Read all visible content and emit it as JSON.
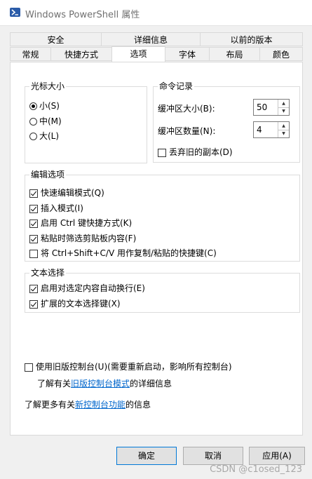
{
  "window": {
    "title": "Windows PowerShell 属性"
  },
  "tabs_row1": [
    "安全",
    "详细信息",
    "以前的版本"
  ],
  "tabs_row2": [
    "常规",
    "快捷方式",
    "选项",
    "字体",
    "布局",
    "颜色"
  ],
  "active_tab": "选项",
  "cursor_size": {
    "legend": "光标大小",
    "options": [
      {
        "label": "小(S)",
        "checked": true
      },
      {
        "label": "中(M)",
        "checked": false
      },
      {
        "label": "大(L)",
        "checked": false
      }
    ]
  },
  "command_history": {
    "legend": "命令记录",
    "buffer_size_label": "缓冲区大小(B):",
    "buffer_size_value": "50",
    "buffer_count_label": "缓冲区数量(N):",
    "buffer_count_value": "4",
    "discard_label": "丢弃旧的副本(D)",
    "discard_checked": false
  },
  "edit_options": {
    "legend": "编辑选项",
    "items": [
      {
        "label": "快速编辑模式(Q)",
        "checked": true
      },
      {
        "label": "插入模式(I)",
        "checked": true
      },
      {
        "label": "启用 Ctrl 键快捷方式(K)",
        "checked": true
      },
      {
        "label": "粘贴时筛选剪贴板内容(F)",
        "checked": true
      },
      {
        "label": "将 Ctrl+Shift+C/V 用作复制/粘贴的快捷键(C)",
        "checked": false
      }
    ]
  },
  "text_selection": {
    "legend": "文本选择",
    "items": [
      {
        "label": "启用对选定内容自动换行(E)",
        "checked": true
      },
      {
        "label": "扩展的文本选择键(X)",
        "checked": true
      }
    ]
  },
  "legacy": {
    "label": "使用旧版控制台(U)(需要重新启动，影响所有控制台)",
    "checked": false,
    "info_prefix": "了解有关",
    "info_link": "旧版控制台模式",
    "info_suffix": "的详细信息"
  },
  "new_features": {
    "prefix": "了解更多有关",
    "link": "新控制台功能",
    "suffix": "的信息"
  },
  "buttons": {
    "ok": "确定",
    "cancel": "取消",
    "apply": "应用(A)"
  },
  "watermark": "CSDN @c1osed_123",
  "colors": {
    "link": "#0066cc",
    "accent": "#0078d7"
  }
}
